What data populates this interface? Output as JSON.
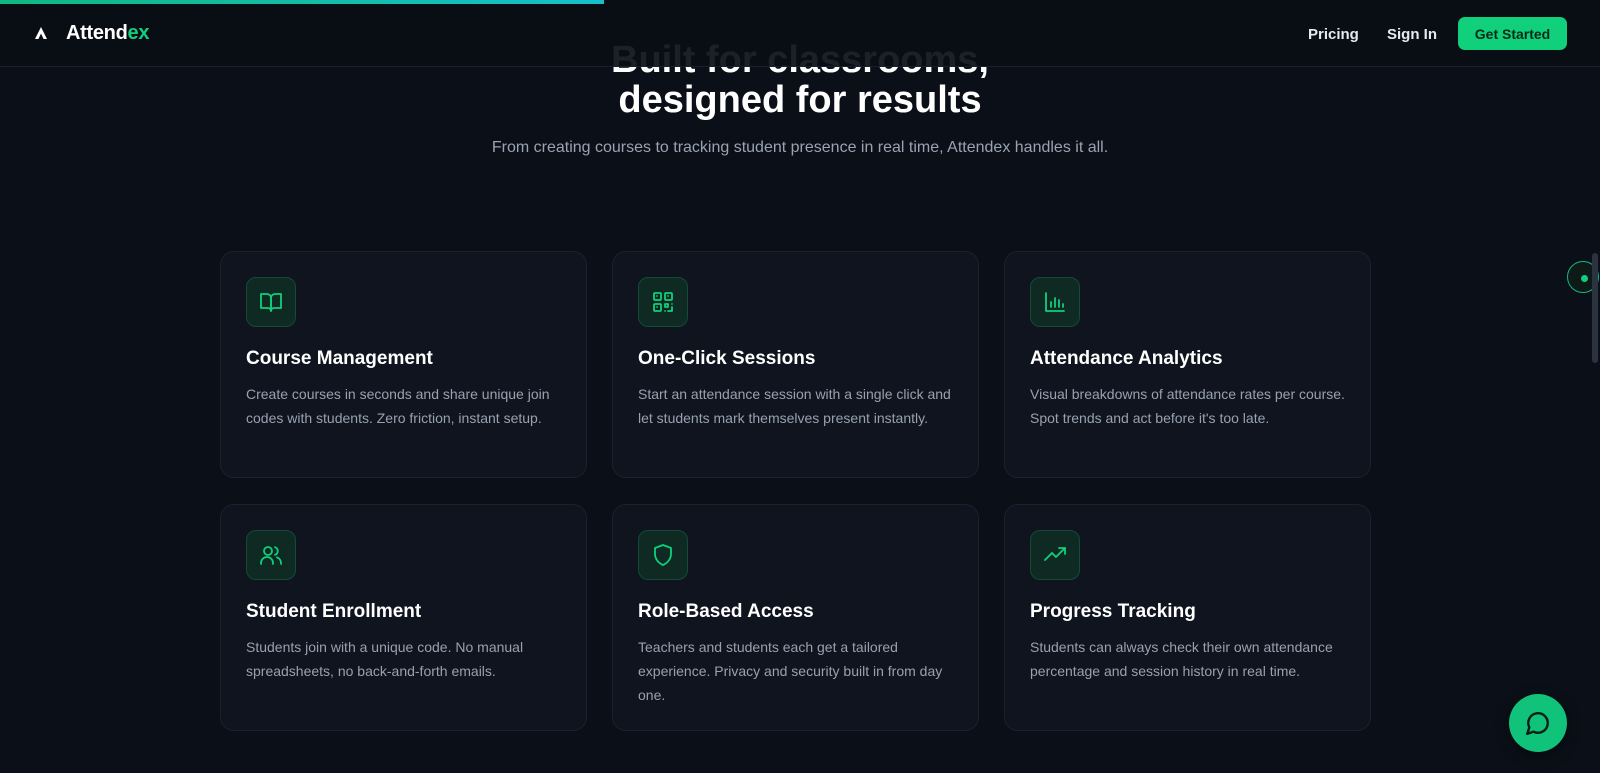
{
  "brand": {
    "name_main": "Attend",
    "name_accent": "ex"
  },
  "nav": {
    "pricing": "Pricing",
    "sign_in": "Sign In",
    "get_started": "Get Started"
  },
  "hero": {
    "title_top": "Built for classrooms,",
    "title": "designed for results",
    "subtitle": "From creating courses to tracking student presence in real time, Attendex handles it all."
  },
  "features": [
    {
      "icon": "book-open-icon",
      "title": "Course Management",
      "description": "Create courses in seconds and share unique join codes with students. Zero friction, instant setup."
    },
    {
      "icon": "qr-code-icon",
      "title": "One-Click Sessions",
      "description": "Start an attendance session with a single click and let students mark themselves present instantly."
    },
    {
      "icon": "bar-chart-icon",
      "title": "Attendance Analytics",
      "description": "Visual breakdowns of attendance rates per course. Spot trends and act before it's too late."
    },
    {
      "icon": "users-icon",
      "title": "Student Enrollment",
      "description": "Students join with a unique code. No manual spreadsheets, no back-and-forth emails."
    },
    {
      "icon": "shield-icon",
      "title": "Role-Based Access",
      "description": "Teachers and students each get a tailored experience. Privacy and security built in from day one."
    },
    {
      "icon": "trending-up-icon",
      "title": "Progress Tracking",
      "description": "Students can always check their own attendance percentage and session history in real time."
    }
  ],
  "colors": {
    "background": "#0b0f17",
    "accent": "#10d07c",
    "card": "#0f141e",
    "icon_bg": "#0e2a23"
  }
}
